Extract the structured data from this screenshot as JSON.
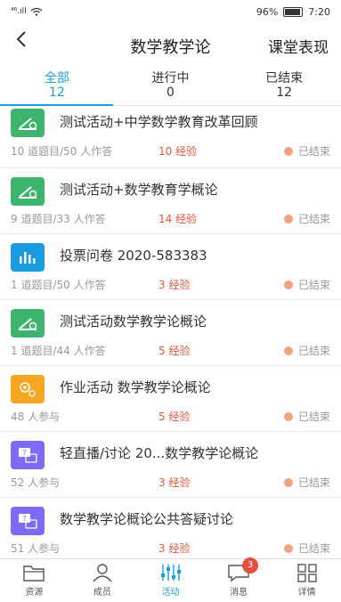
{
  "status_bar": {
    "signal": "⁴⁶.ıll",
    "battery": "96%",
    "time": "7:20"
  },
  "header": {
    "title": "数学教学论",
    "action": "课堂表现"
  },
  "tabs": [
    {
      "label": "全部",
      "count": "12"
    },
    {
      "label": "进行中",
      "count": "0"
    },
    {
      "label": "已结束",
      "count": "12"
    }
  ],
  "items": [
    {
      "icon": "test-icon",
      "title": "测试活动+中学数学教育改革回顾",
      "meta": "10 道题目/50 人作答",
      "exp": "10 经验",
      "status": "已结束"
    },
    {
      "icon": "test-icon",
      "title": "测试活动+数学教育学概论",
      "meta": "9 道题目/33 人作答",
      "exp": "14 经验",
      "status": "已结束"
    },
    {
      "icon": "vote-icon",
      "title": "投票问卷 2020-583383",
      "meta": "1 道题目/50 人作答",
      "exp": "3 经验",
      "status": "已结束"
    },
    {
      "icon": "test-icon",
      "title": "测试活动数学教学论概论",
      "meta": "1 道题目/44 人作答",
      "exp": "5 经验",
      "status": "已结束"
    },
    {
      "icon": "homework-icon",
      "title": "作业活动 数学教学论概论",
      "meta": "48 人参与",
      "exp": "5 经验",
      "status": "已结束"
    },
    {
      "icon": "discussion-icon",
      "title": "轻直播/讨论 20...数学教学论概论",
      "meta": "52 人参与",
      "exp": "3 经验",
      "status": "已结束"
    },
    {
      "icon": "discussion-icon",
      "title": "数学教学论概论公共答疑讨论",
      "meta": "51 人参与",
      "exp": "3 经验",
      "status": "已结束"
    }
  ],
  "bottom_nav": [
    {
      "label": "资源",
      "icon": "folder-icon"
    },
    {
      "label": "成员",
      "icon": "person-icon"
    },
    {
      "label": "活动",
      "icon": "activity-icon"
    },
    {
      "label": "消息",
      "icon": "message-icon",
      "badge": "3"
    },
    {
      "label": "详情",
      "icon": "grid-icon"
    }
  ],
  "colors": {
    "accent": "#1aa0d8",
    "test": "#3cb46e",
    "vote": "#1c9be0",
    "homework": "#f5a623",
    "discussion": "#7b6cf2",
    "exp": "#e2583a"
  }
}
